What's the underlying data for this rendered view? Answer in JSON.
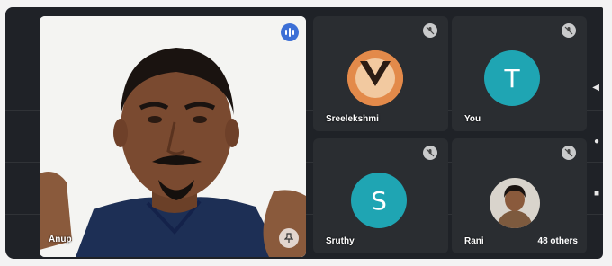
{
  "main_speaker": {
    "name": "Anup"
  },
  "participants": [
    {
      "name": "Sreelekshmi",
      "avatar_type": "photo",
      "muted": true
    },
    {
      "name": "You",
      "avatar_type": "initial",
      "initial": "T",
      "avatar_color": "#1fa5b3",
      "muted": true
    },
    {
      "name": "Sruthy",
      "avatar_type": "initial",
      "initial": "S",
      "avatar_color": "#1fa5b3",
      "muted": true
    },
    {
      "name": "Rani",
      "avatar_type": "photo",
      "muted": true
    }
  ],
  "others_label": "48 others",
  "icons": {
    "speaking": "audio-level-icon",
    "pin": "pin-icon",
    "mute": "mic-off-icon",
    "back": "triangle-back-icon",
    "home": "circle-home-icon",
    "recents": "square-recents-icon"
  },
  "colors": {
    "tile_bg": "#2a2d31",
    "screen_bg": "#1f2227",
    "accent": "#3c6fd6"
  }
}
